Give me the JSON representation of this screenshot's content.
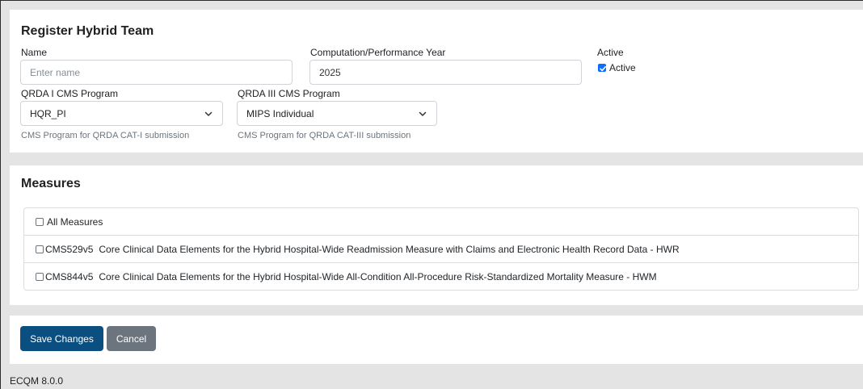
{
  "register": {
    "title": "Register Hybrid Team",
    "name_label": "Name",
    "name_placeholder": "Enter name",
    "year_label": "Computation/Performance Year",
    "year_value": "2025",
    "active_label": "Active",
    "active_checkbox_label": "Active",
    "active_checked": true,
    "qrda1_label": "QRDA I CMS Program",
    "qrda1_value": "HQR_PI",
    "qrda1_help": "CMS Program for QRDA CAT-I submission",
    "qrda3_label": "QRDA III CMS Program",
    "qrda3_value": "MIPS Individual",
    "qrda3_help": "CMS Program for QRDA CAT-III submission"
  },
  "measures": {
    "title": "Measures",
    "all_label": "All Measures",
    "items": [
      {
        "code": "CMS529v5",
        "description": "Core Clinical Data Elements for the Hybrid Hospital-Wide Readmission Measure with Claims and Electronic Health Record Data - HWR"
      },
      {
        "code": "CMS844v5",
        "description": "Core Clinical Data Elements for the Hybrid Hospital-Wide All-Condition All-Procedure Risk-Standardized Mortality Measure - HWM"
      }
    ]
  },
  "actions": {
    "save_label": "Save Changes",
    "cancel_label": "Cancel"
  },
  "footer": {
    "version": "ECQM 8.0.0"
  },
  "colors": {
    "primary": "#0b4f80",
    "secondary": "#6c757d",
    "checkbox_checked": "#0d6efd",
    "page_background": "#e4e4e4"
  }
}
